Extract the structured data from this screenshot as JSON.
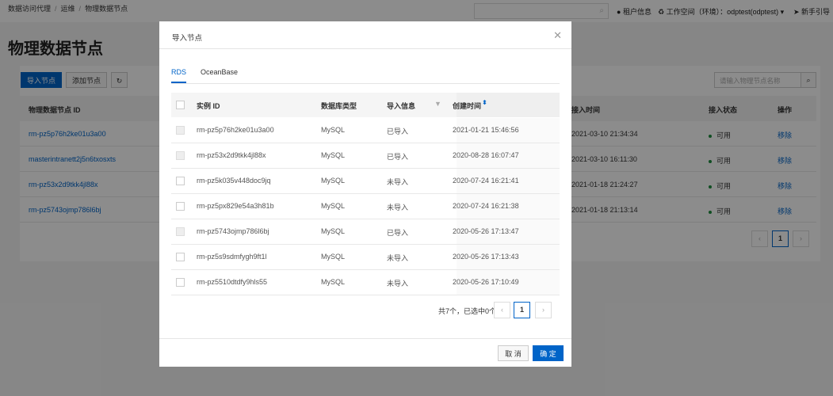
{
  "breadcrumb": [
    "数据访问代理",
    "运维",
    "物理数据节点"
  ],
  "topbar": {
    "account": "租户信息",
    "workspace": "工作空间（环境）：",
    "workspace_value": "odptest(odptest)",
    "guide": "新手引导"
  },
  "page": {
    "title": "物理数据节点",
    "import_button": "导入节点",
    "add_button": "添加节点",
    "search_placeholder": "请输入物理节点名称",
    "columns": [
      "物理数据节点 ID",
      "接入时间",
      "接入状态",
      "操作"
    ],
    "rows": [
      {
        "id": "rm-pz5p76h2ke01u3a00",
        "time": "2021-03-10 21:34:34",
        "status": "可用",
        "action": "移除"
      },
      {
        "id": "masterintranett2j5n6txosxts",
        "time": "2021-03-10 16:11:30",
        "status": "可用",
        "action": "移除"
      },
      {
        "id": "rm-pz53x2d9tkk4jl88x",
        "time": "2021-01-18 21:24:27",
        "status": "可用",
        "action": "移除"
      },
      {
        "id": "rm-pz5743ojmp786l6bj",
        "time": "2021-01-18 21:13:14",
        "status": "可用",
        "action": "移除"
      }
    ],
    "pagination": {
      "current": "1",
      "prev": "‹",
      "next": "›"
    }
  },
  "modal": {
    "title": "导入节点",
    "tabs": [
      "RDS",
      "OceanBase"
    ],
    "active_tab": "RDS",
    "columns": [
      "实例 ID",
      "数据库类型",
      "导入信息",
      "创建时间"
    ],
    "rows": [
      {
        "id": "rm-pz5p76h2ke01u3a00",
        "type": "MySQL",
        "info": "已导入",
        "time": "2021-01-21 15:46:56",
        "disabled": true
      },
      {
        "id": "rm-pz53x2d9tkk4jl88x",
        "type": "MySQL",
        "info": "已导入",
        "time": "2020-08-28 16:07:47",
        "disabled": true
      },
      {
        "id": "rm-pz5k035v448doc9jq",
        "type": "MySQL",
        "info": "未导入",
        "time": "2020-07-24 16:21:41",
        "disabled": false
      },
      {
        "id": "rm-pz5px829e54a3h81b",
        "type": "MySQL",
        "info": "未导入",
        "time": "2020-07-24 16:21:38",
        "disabled": false
      },
      {
        "id": "rm-pz5743ojmp786l6bj",
        "type": "MySQL",
        "info": "已导入",
        "time": "2020-05-26 17:13:47",
        "disabled": true
      },
      {
        "id": "rm-pz5s9sdmfygh9ft1l",
        "type": "MySQL",
        "info": "未导入",
        "time": "2020-05-26 17:13:43",
        "disabled": false
      },
      {
        "id": "rm-pz5510dtdfy9hls55",
        "type": "MySQL",
        "info": "未导入",
        "time": "2020-05-26 17:10:49",
        "disabled": false
      }
    ],
    "summary": "共7个，已选中0个",
    "page": "1",
    "prev": "‹",
    "next": "›",
    "cancel": "取 消",
    "ok": "确 定"
  },
  "colors": {
    "primary": "#0064c8",
    "status_ok": "#1e8e3e"
  }
}
